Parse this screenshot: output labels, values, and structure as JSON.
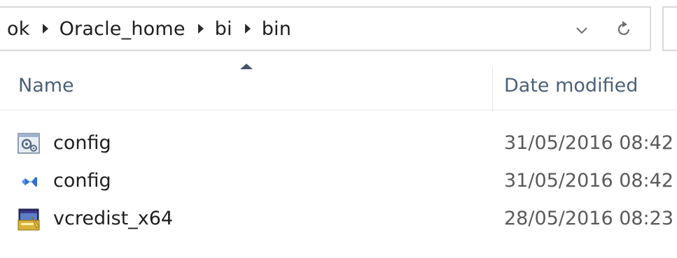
{
  "address_bar": {
    "breadcrumbs": [
      "ok",
      "Oracle_home",
      "bi",
      "bin"
    ],
    "dropdown_icon": "chevron-down-icon",
    "refresh_icon": "refresh-icon"
  },
  "columns": {
    "name": "Name",
    "date_modified": "Date modified",
    "sorted_by": "Name",
    "sort_direction": "ascending"
  },
  "files": [
    {
      "name": "config",
      "date": "31/05/2016 08:42",
      "icon": "config-settings-file-icon"
    },
    {
      "name": "config",
      "date": "31/05/2016 08:42",
      "icon": "visual-studio-file-icon"
    },
    {
      "name": "vcredist_x64",
      "date": "28/05/2016 08:23",
      "icon": "installer-exe-icon"
    }
  ],
  "colors": {
    "header_text": "#4c607a",
    "border": "#d9d9d9",
    "vs_blue": "#2f6fd0"
  }
}
